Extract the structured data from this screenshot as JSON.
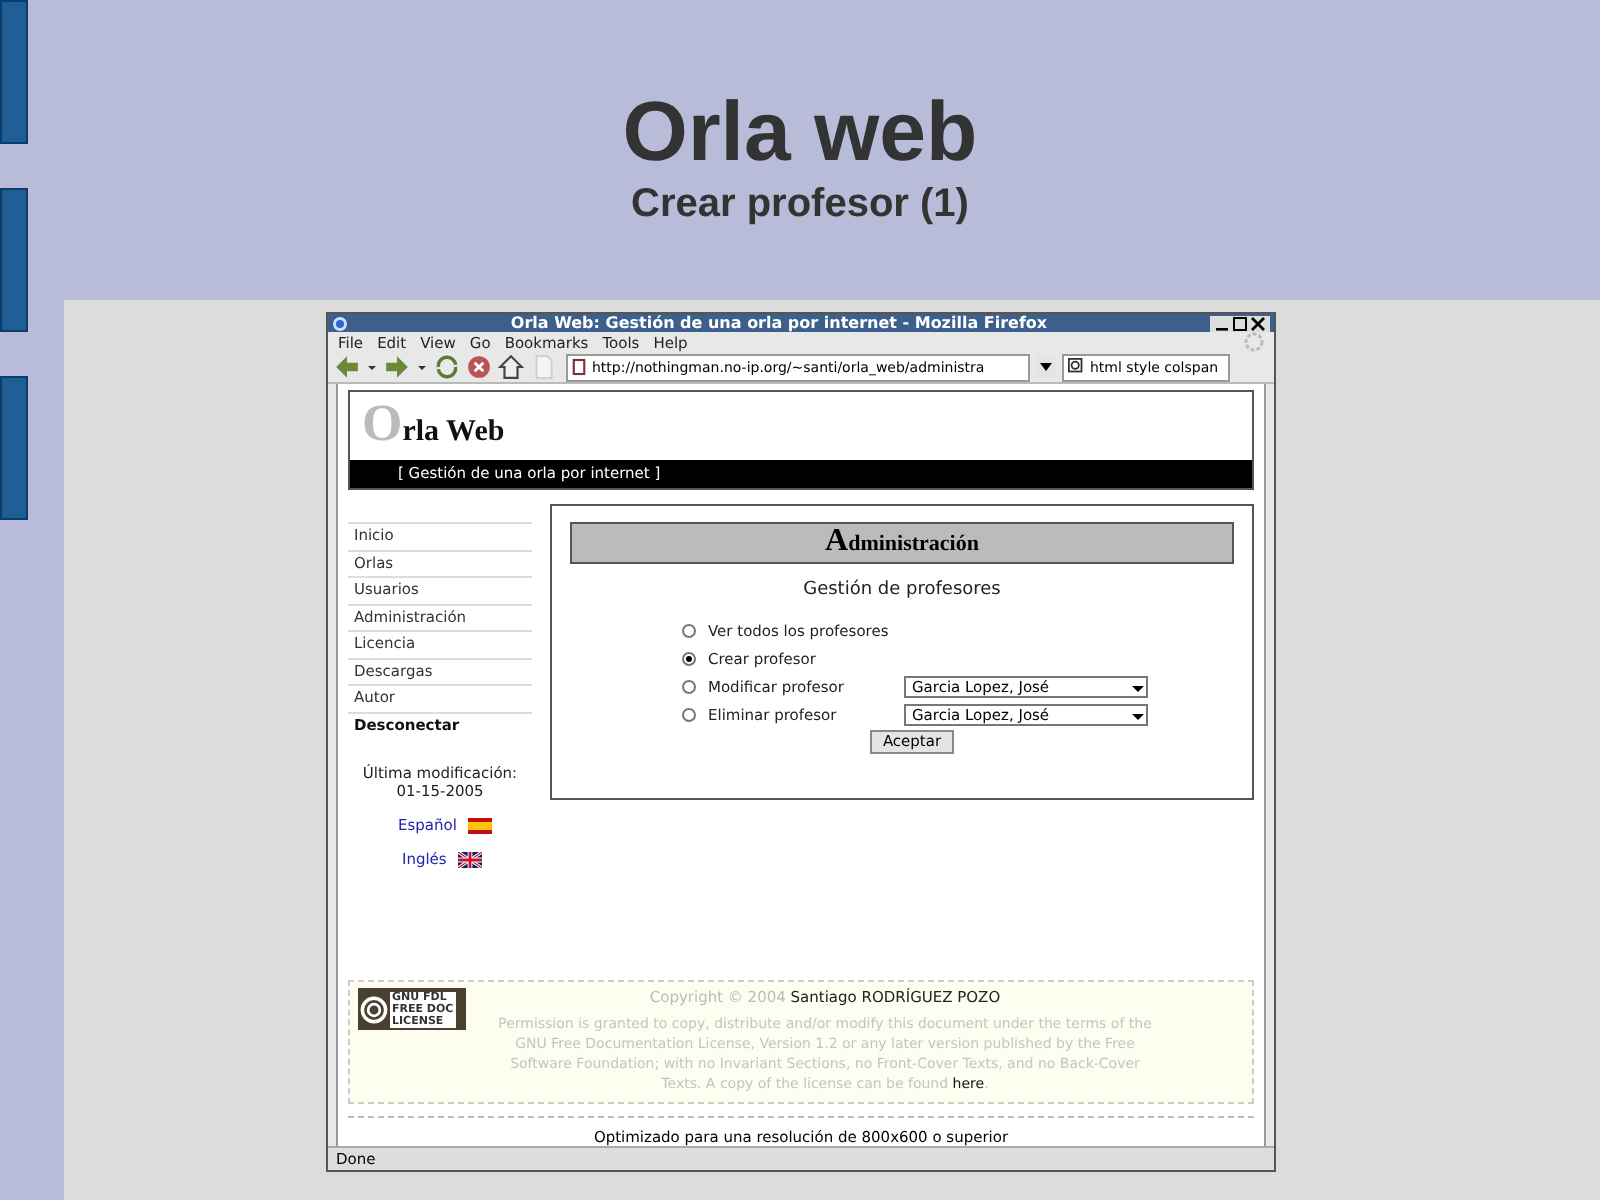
{
  "slide": {
    "title": "Orla web",
    "subtitle": "Crear profesor (1)"
  },
  "browser": {
    "title": "Orla Web: Gestión de una orla por internet - Mozilla Firefox",
    "menu": [
      "File",
      "Edit",
      "View",
      "Go",
      "Bookmarks",
      "Tools",
      "Help"
    ],
    "url": "http://nothingman.no-ip.org/~santi/orla_web/administra",
    "search": "html style colspan",
    "status": "Done"
  },
  "site": {
    "logo_initial": "O",
    "logo_rest": "rla Web",
    "tagline": "[ Gestión de una orla por internet ]",
    "nav": [
      {
        "label": "Inicio",
        "bold": false
      },
      {
        "label": "Orlas",
        "bold": false
      },
      {
        "label": "Usuarios",
        "bold": false
      },
      {
        "label": "Administración",
        "bold": false
      },
      {
        "label": "Licencia",
        "bold": false
      },
      {
        "label": "Descargas",
        "bold": false
      },
      {
        "label": "Autor",
        "bold": false
      },
      {
        "label": "Desconectar",
        "bold": true
      }
    ],
    "last_modified_label": "Última modificación:",
    "last_modified_date": "01-15-2005",
    "languages": [
      {
        "label": "Español",
        "kind": "es"
      },
      {
        "label": "Inglés",
        "kind": "uk"
      }
    ]
  },
  "panel": {
    "heading_initial": "A",
    "heading_rest": "dministración",
    "subheading": "Gestión de profesores",
    "options": [
      {
        "label": "Ver todos los profesores",
        "selected": false
      },
      {
        "label": "Crear profesor",
        "selected": true
      },
      {
        "label": "Modificar profesor",
        "selected": false,
        "select_value": "Garcia Lopez, José"
      },
      {
        "label": "Eliminar profesor",
        "selected": false,
        "select_value": "Garcia Lopez, José"
      }
    ],
    "button": "Aceptar"
  },
  "footer": {
    "badge": [
      "GNU FDL",
      "FREE DOC",
      "LICENSE"
    ],
    "copyright": "Copyright © 2004",
    "author": "Santiago RODRÍGUEZ POZO",
    "license": "Permission is granted to copy, distribute and/or modify this document under the terms of the GNU Free Documentation License, Version 1.2 or any later version published by the Free Software Foundation; with no Invariant Sections, no Front-Cover Texts, and no Back-Cover Texts. A copy of the license can be found",
    "license_link": "here",
    "license_end": ".",
    "note": "Optimizado para una resolución de 800x600 o superior"
  }
}
